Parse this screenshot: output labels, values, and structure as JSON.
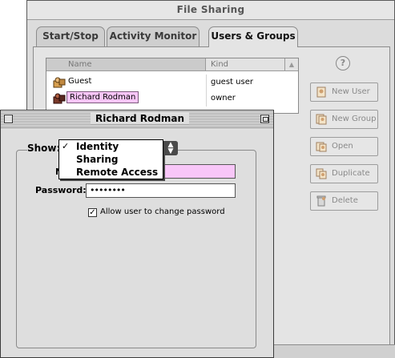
{
  "file_sharing": {
    "title": "File Sharing",
    "tabs": [
      {
        "label": "Start/Stop",
        "active": false
      },
      {
        "label": "Activity Monitor",
        "active": false
      },
      {
        "label": "Users & Groups",
        "active": true
      }
    ],
    "help_icon": "?",
    "list": {
      "columns": [
        "Name",
        "Kind"
      ],
      "rows": [
        {
          "name": "Guest",
          "kind": "guest user",
          "icon": "guest-user-icon"
        },
        {
          "name": "Richard Rodman",
          "kind": "owner",
          "icon": "owner-user-icon",
          "selected": true
        }
      ]
    },
    "buttons": {
      "new_user": "New User",
      "new_group": "New Group",
      "open": "Open",
      "duplicate": "Duplicate",
      "delete": "Delete"
    }
  },
  "user_window": {
    "title": "Richard Rodman",
    "show_label": "Show:",
    "menu": {
      "items": [
        {
          "label": "Identity",
          "checked": true
        },
        {
          "label": "Sharing",
          "checked": false
        },
        {
          "label": "Remote Access",
          "checked": false
        }
      ],
      "checkmark": "✓"
    },
    "name_label_visible": "N",
    "password_label": "Password:",
    "password_value": "••••••••",
    "allow_change_label": "Allow user to change password",
    "allow_change_checked": true,
    "allow_change_mark": "✓"
  },
  "colors": {
    "selection_pink": "#f8c6f8",
    "window_gray": "#dedede"
  }
}
